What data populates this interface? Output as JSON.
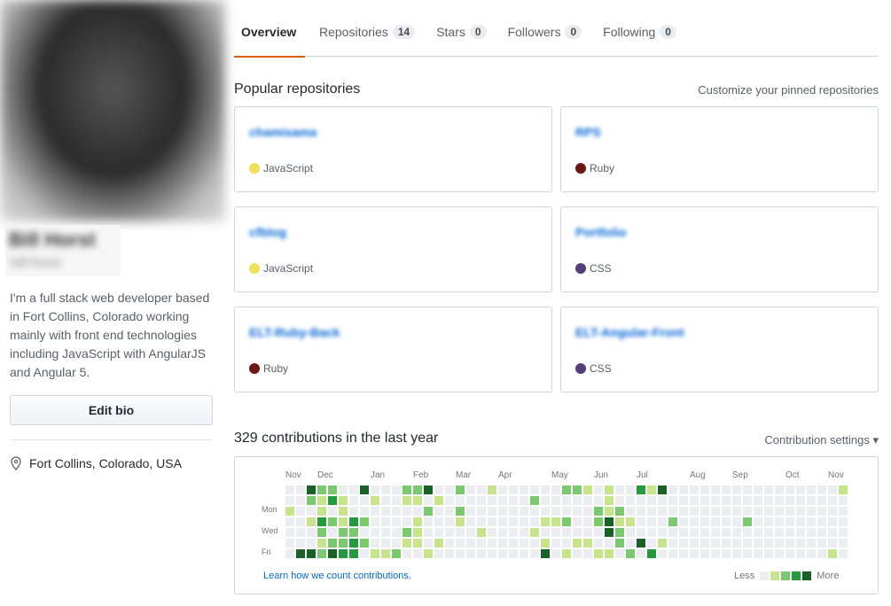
{
  "profile": {
    "full_name": "Bill Horst",
    "login": "bill-horst",
    "bio": "I'm a full stack web developer based in Fort Collins, Colorado working mainly with front end technologies including JavaScript with AngularJS and Angular 5.",
    "edit_bio_label": "Edit bio",
    "location": "Fort Collins, Colorado, USA"
  },
  "tabs": [
    {
      "label": "Overview",
      "active": true
    },
    {
      "label": "Repositories",
      "count": "14"
    },
    {
      "label": "Stars",
      "count": "0"
    },
    {
      "label": "Followers",
      "count": "0"
    },
    {
      "label": "Following",
      "count": "0"
    }
  ],
  "pinned": {
    "title": "Popular repositories",
    "customize_label": "Customize your pinned repositories",
    "repos": [
      {
        "name": "chamisama",
        "language": "JavaScript",
        "color": "#f1e05a"
      },
      {
        "name": "RPS",
        "language": "Ruby",
        "color": "#701516"
      },
      {
        "name": "cfblog",
        "language": "JavaScript",
        "color": "#f1e05a"
      },
      {
        "name": "Portfolio",
        "language": "CSS",
        "color": "#563d7c"
      },
      {
        "name": "ELT-Ruby-Back",
        "language": "Ruby",
        "color": "#701516"
      },
      {
        "name": "ELT-Angular-Front",
        "language": "CSS",
        "color": "#563d7c"
      }
    ]
  },
  "contributions": {
    "title": "329 contributions in the last year",
    "settings_label": "Contribution settings ▾",
    "months": [
      "Nov",
      "Dec",
      "Jan",
      "Feb",
      "Mar",
      "Apr",
      "May",
      "Jun",
      "Jul",
      "Aug",
      "Sep",
      "Oct",
      "Nov"
    ],
    "day_labels": [
      "",
      "Mon",
      "",
      "Wed",
      "",
      "Fri",
      ""
    ],
    "levels_by_day": [
      "00422004000224002001000000221010031400000000000000001",
      "00213100100110100000000200000010000000000000000000000",
      "10010100000002002000000000000212000000000000000000000",
      "00132132000010001000000011200241100020000002000000000",
      "00020220000210000010000100000042000000000000000000000",
      "00012232000110100000000010011002040100000000000000000",
      "04424330112001000000000040100110203000000000000000010"
    ],
    "level_colors": [
      "#ebedf0",
      "#c6e48b",
      "#7bc96f",
      "#239a3b",
      "#196127"
    ],
    "learn_label": "Learn how we count contributions.",
    "less_label": "Less",
    "more_label": "More"
  }
}
